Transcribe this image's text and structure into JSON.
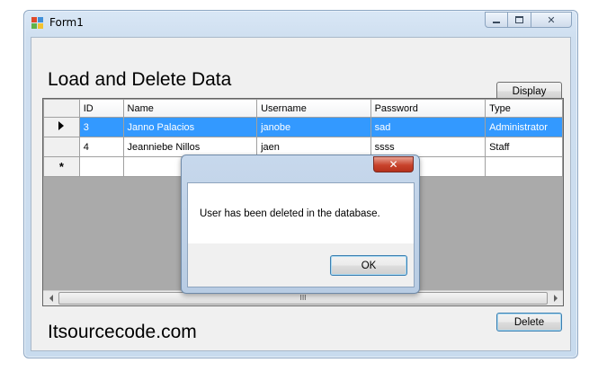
{
  "window": {
    "title": "Form1",
    "heading": "Load and Delete Data",
    "footer": "Itsourcecode.com",
    "buttons": {
      "display": "Display",
      "delete": "Delete"
    },
    "caption_icons": {
      "minimize": "minimize-icon",
      "maximize": "maximize-icon",
      "close": "close-icon"
    }
  },
  "grid": {
    "columns": [
      "ID",
      "Name",
      "Username",
      "Password",
      "Type"
    ],
    "rows": [
      {
        "id": "3",
        "name": "Janno Palacios",
        "username": "janobe",
        "password": "sad",
        "type": "Administrator",
        "selected": true
      },
      {
        "id": "4",
        "name": "Jeanniebe Nillos",
        "username": "jaen",
        "password": "ssss",
        "type": "Staff",
        "selected": false
      }
    ],
    "new_row_marker": "*",
    "scroll_grip": "III"
  },
  "dialog": {
    "message": "User has been deleted in the database.",
    "ok": "OK",
    "close_glyph": "✕"
  },
  "colors": {
    "selection": "#3399ff",
    "grid_background": "#aaaaaa",
    "dialog_close": "#c8432c"
  }
}
